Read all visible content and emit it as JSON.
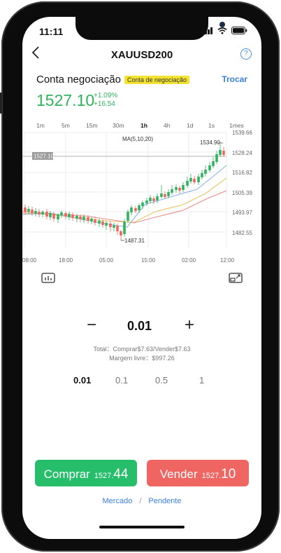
{
  "status": {
    "time": "11:11"
  },
  "header": {
    "title": "XAUUSD200",
    "help": "?"
  },
  "account": {
    "label": "Conta negociação",
    "badge": "Conta de negociação",
    "switch_label": "Trocar"
  },
  "quote": {
    "price": "1527.10",
    "change_pct": "+1.09%",
    "change_abs": "+16.54"
  },
  "timeframes": [
    "1m",
    "5m",
    "15m",
    "30m",
    "1h",
    "4h",
    "1d",
    "1s",
    "1mes"
  ],
  "active_timeframe": "1h",
  "chart_data": {
    "type": "candlestick",
    "indicator_label": "MA(5,10,20)",
    "y_ticks": [
      "1539.66",
      "1528.24",
      "1516.82",
      "1505.39",
      "1493.97",
      "1482.55"
    ],
    "y_range": [
      1482.55,
      1539.66
    ],
    "x_ticks": [
      "08:00",
      "18:00",
      "05:00",
      "15:00",
      "02:00",
      "12:00"
    ],
    "current_price_label": "1527.10",
    "current_price_right": "1528.24",
    "high_annotation": "1534.90",
    "low_annotation": "1487.31"
  },
  "order": {
    "minus": "−",
    "volume": "0.01",
    "plus": "+",
    "total_line": "Total：Comprar$7.63/Vender$7.63",
    "margin_line": "Margem livre：$997.26",
    "lot_options": [
      "0.01",
      "0.1",
      "0.5",
      "1"
    ]
  },
  "buttons": {
    "buy_label": "Comprar",
    "buy_price_small": "1527.",
    "buy_price_big": "44",
    "sell_label": "Vender",
    "sell_price_small": "1527.",
    "sell_price_big": "10"
  },
  "modes": {
    "market": "Mercado",
    "separator": "/",
    "pending": "Pendente"
  },
  "colors": {
    "up": "#2fb35c",
    "down": "#ee6562",
    "accent": "#3b7fde",
    "badge": "#f3e230"
  },
  "icons": [
    "back-icon",
    "help-icon",
    "indicator-icon",
    "fullscreen-icon",
    "wifi-icon",
    "signal-icon",
    "battery-icon"
  ]
}
